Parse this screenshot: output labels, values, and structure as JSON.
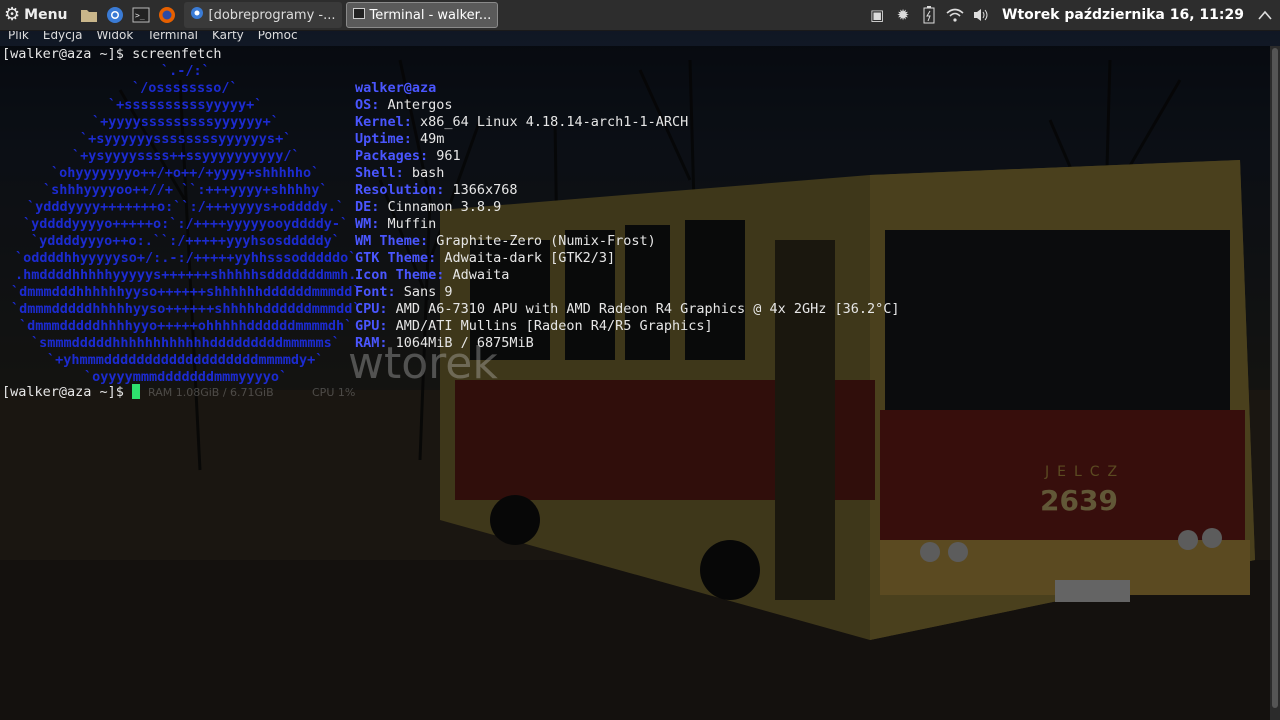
{
  "panel": {
    "menu_label": "Menu",
    "windows": [
      {
        "label": "[dobreprogramy -...",
        "active": false
      },
      {
        "label": "Terminal - walker...",
        "active": true
      }
    ],
    "clock": "Wtorek października 16, 11:29"
  },
  "terminal_menu": [
    "Plik",
    "Edycja",
    "Widok",
    "Terminal",
    "Karty",
    "Pomoc"
  ],
  "terminal": {
    "prompt": "[walker@aza ~]$",
    "command": "screenfetch",
    "info": [
      {
        "key": "walker@aza",
        "value": ""
      },
      {
        "key": "OS:",
        "value": " Antergos"
      },
      {
        "key": "Kernel:",
        "value": " x86_64 Linux 4.18.14-arch1-1-ARCH"
      },
      {
        "key": "Uptime:",
        "value": " 49m"
      },
      {
        "key": "Packages:",
        "value": " 961"
      },
      {
        "key": "Shell:",
        "value": " bash"
      },
      {
        "key": "Resolution:",
        "value": " 1366x768"
      },
      {
        "key": "DE:",
        "value": " Cinnamon 3.8.9"
      },
      {
        "key": "WM:",
        "value": " Muffin"
      },
      {
        "key": "WM Theme:",
        "value": " Graphite-Zero (Numix-Frost)"
      },
      {
        "key": "GTK Theme:",
        "value": " Adwaita-dark [GTK2/3]"
      },
      {
        "key": "Icon Theme:",
        "value": " Adwaita"
      },
      {
        "key": "Font:",
        "value": " Sans 9"
      },
      {
        "key": "CPU:",
        "value": " AMD A6-7310 APU with AMD Radeon R4 Graphics @ 4x 2GHz [36.2°C]"
      },
      {
        "key": "GPU:",
        "value": " AMD/ATI Mullins [Radeon R4/R5 Graphics]"
      },
      {
        "key": "RAM:",
        "value": " 1064MiB / 6875MiB"
      }
    ],
    "logo_lines": [
      "`.-/:`",
      "`/ossssssso/`",
      "`+ssssssssssyyyyy+`",
      "`+yyyysssssssssyyyyyy+`",
      "`+syyyyyyssssssssyyyyyys+`",
      "`+ysyyyyssss++ssyyyyyyyyyy/`",
      "`ohyyyyyyyo++/+o++/+yyyy+shhhhho`",
      "`shhhyyyyoo++//+ ``:+++yyyy+shhhhy`",
      "`ydddyyyy+++++++o:``:/+++yyyys+oddddy.`",
      "`yddddyyyyo+++++o:`:/++++yyyyyooyddddy-`",
      "`yddddyyyo++o:.``:/+++++yyyhsosdddddy`",
      "`oddddhhyyyyyso+/:.-:/+++++yyhhsssodddddo`",
      ".hmddddhhhhhyyyyys++++++shhhhhsdddddddmmh.",
      "`dmmmdddhhhhhhyyso++++++shhhhhhddddddmmmdd`",
      "`dmmmdddddhhhhhyyso++++++shhhhhddddddmmmdd`",
      "`dmmmdddddhhhhyyo+++++ohhhhhddddddmmmmdh`",
      "`smmmdddddhhhhhhhhhhhhdddddddddmmmmms`",
      "`+yhmmmdddddddddddddddddddmmmmdy+`",
      "`oyyyymmmdddddddmmmyyyyo`"
    ],
    "conky_day": "wtorek",
    "conky_ram": "RAM  1.08GiB / 6.71GiB",
    "conky_cpu": "CPU  1%"
  }
}
